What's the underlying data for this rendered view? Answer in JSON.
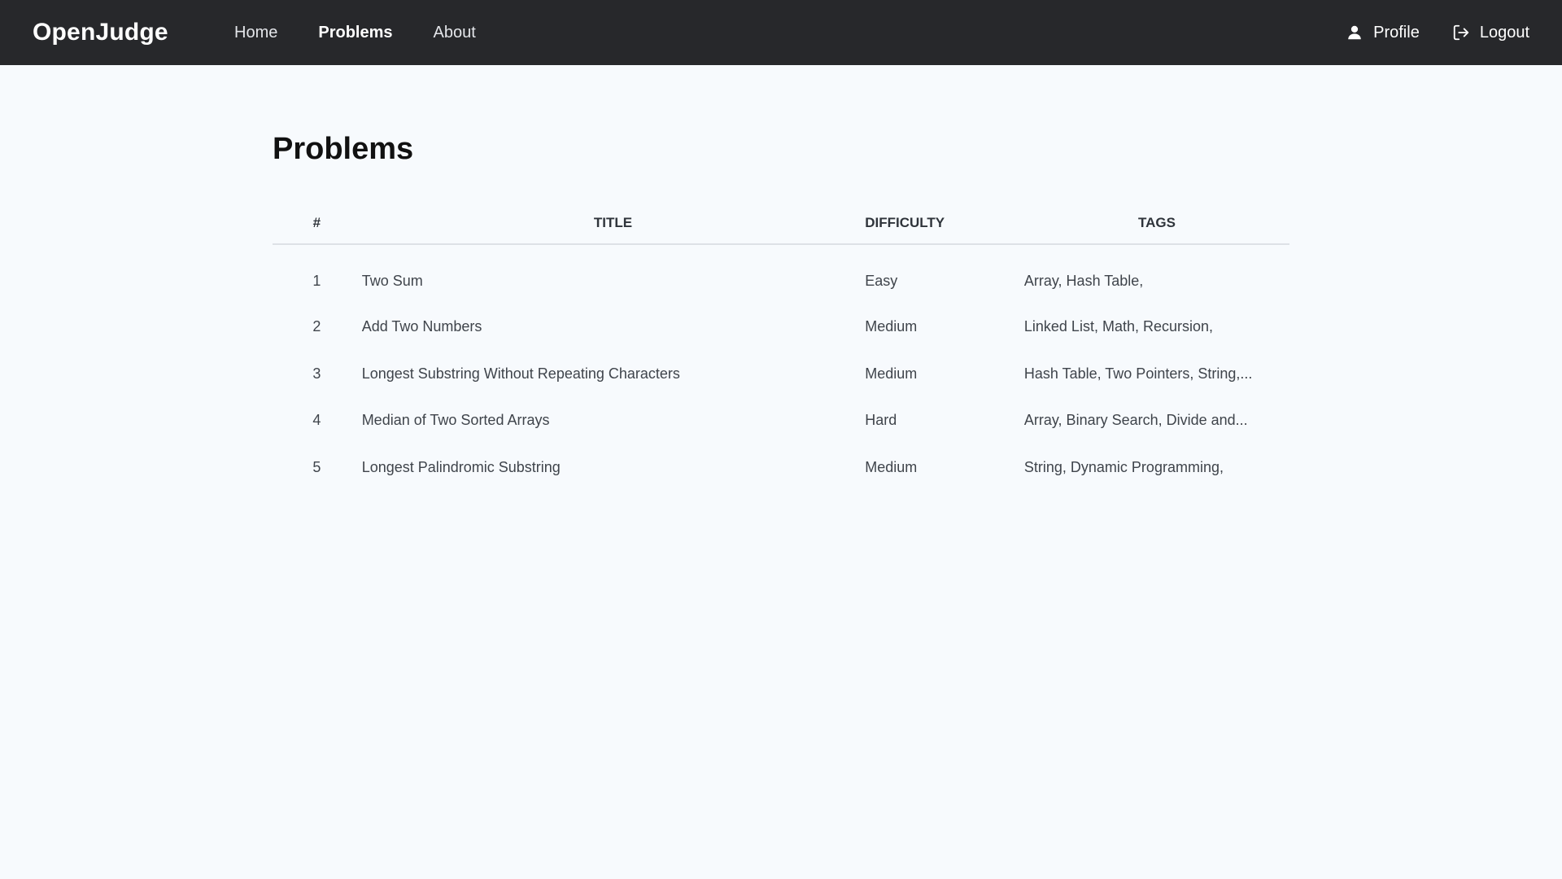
{
  "navbar": {
    "brand": "OpenJudge",
    "links": [
      {
        "label": "Home",
        "active": false
      },
      {
        "label": "Problems",
        "active": true
      },
      {
        "label": "About",
        "active": false
      }
    ],
    "profile_label": "Profile",
    "logout_label": "Logout",
    "profile_icon": "user-icon",
    "logout_icon": "logout-icon"
  },
  "page": {
    "title": "Problems"
  },
  "table": {
    "headers": {
      "num": "#",
      "title": "TITLE",
      "difficulty": "DIFFICULTY",
      "tags": "TAGS"
    },
    "rows": [
      {
        "num": "1",
        "title": "Two Sum",
        "difficulty": "Easy",
        "tags": "Array, Hash Table,"
      },
      {
        "num": "2",
        "title": "Add Two Numbers",
        "difficulty": "Medium",
        "tags": "Linked List, Math, Recursion,"
      },
      {
        "num": "3",
        "title": "Longest Substring Without Repeating Characters",
        "difficulty": "Medium",
        "tags": "Hash Table, Two Pointers, String,..."
      },
      {
        "num": "4",
        "title": "Median of Two Sorted Arrays",
        "difficulty": "Hard",
        "tags": "Array, Binary Search, Divide and..."
      },
      {
        "num": "5",
        "title": "Longest Palindromic Substring",
        "difficulty": "Medium",
        "tags": "String, Dynamic Programming,"
      }
    ]
  },
  "colors": {
    "navbar_bg": "#27282b",
    "page_bg": "#f7fafd",
    "text": "#3f444b",
    "heading": "#111111"
  }
}
